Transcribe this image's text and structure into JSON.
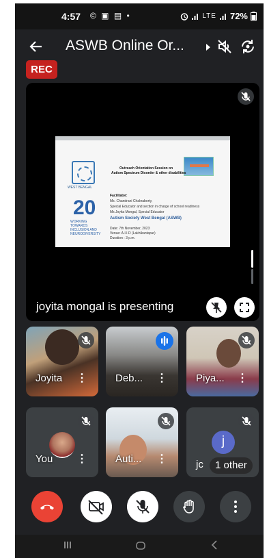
{
  "status_bar": {
    "time": "4:57",
    "notification_icons": "© ▣ ▤ •",
    "network": "LTE",
    "battery": "72%"
  },
  "app_bar": {
    "title": "ASWB Online Or...",
    "icons": [
      "back-arrow-icon",
      "caret-right-icon",
      "speaker-off-icon",
      "switch-camera-icon"
    ]
  },
  "recording_badge": "REC",
  "presentation": {
    "label": "joyita mongal is presenting",
    "slide": {
      "heading_line1": "Outreach Orientation Session on",
      "heading_line2": "Autism Spectrum Disorder & other disabilities",
      "logo_caption": "WEST BENGAL",
      "twenty": "20",
      "twenty_caption": "WORKING TOWARDS INCLUSION AND NEURODIVERSITY",
      "facilitator": "Facilitator:",
      "person1": "Ms. Chandrani Chakraborty,",
      "role1": "Special Educator and section in charge of school readiness",
      "person2": "Ms Joyita Mongal, Special Educator",
      "org": "Autism Society West Bengal (ASWB)",
      "date": "Date: 7th November, 2023",
      "venue": "Venue: A.I.I.D (Lakhikantapur)",
      "duration": "Duration : 3 p.m."
    }
  },
  "participants": [
    {
      "name": "Joyita",
      "mic": "muted"
    },
    {
      "name": "Deb...",
      "mic": "speaking"
    },
    {
      "name": "Piya...",
      "mic": "muted"
    },
    {
      "name": "You",
      "mic": "muted"
    },
    {
      "name": "Auti...",
      "mic": "muted"
    },
    {
      "name": "jc",
      "mic": "muted",
      "initial": "j",
      "others": "1 other"
    }
  ],
  "controls": [
    "end-call-icon",
    "camera-off-icon",
    "mic-off-icon",
    "raise-hand-icon",
    "more-options-icon"
  ],
  "colors": {
    "background": "#202124",
    "end_call": "#ea4335",
    "rec_badge": "#c5221f",
    "avatar_j": "#5a6ac9"
  }
}
